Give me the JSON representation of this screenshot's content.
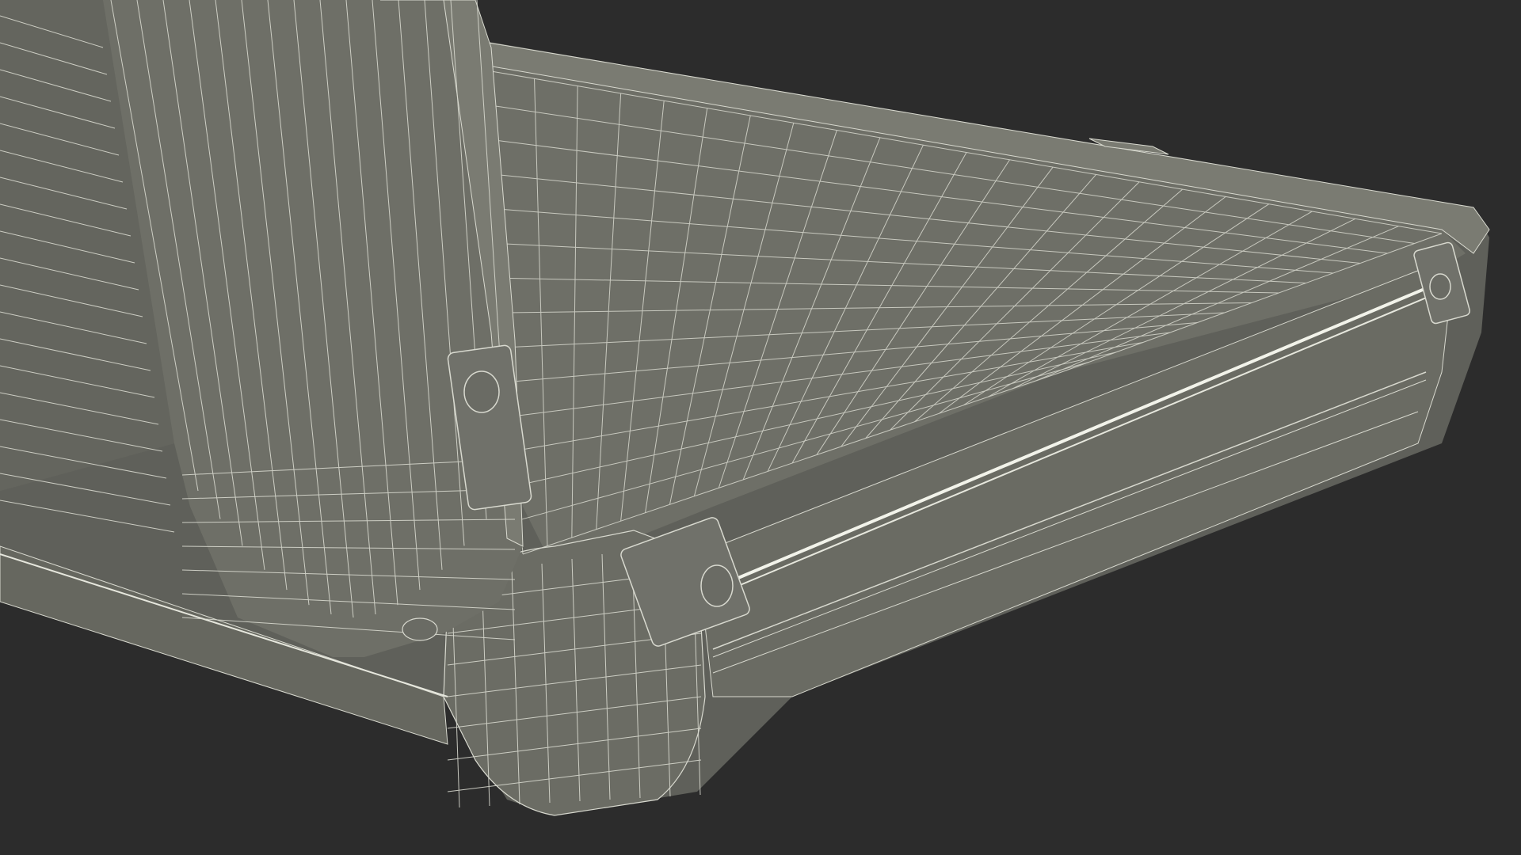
{
  "scene": {
    "subject": "wireframe-render",
    "colors": {
      "background": "#2c2c2c",
      "surface": "#6e6f67",
      "surface_dark": "#5e5f58",
      "surface_light": "#7c7d74",
      "wire": "#d8d9cf",
      "wire_bright": "#f2f3ea"
    }
  }
}
